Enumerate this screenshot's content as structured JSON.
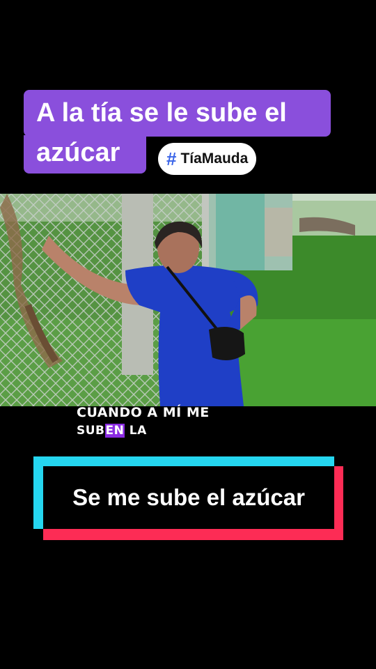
{
  "title": {
    "line1": "A la tía se le sube el",
    "line2": "azúcar"
  },
  "hashtag": {
    "symbol": "#",
    "label": "TíaMauda"
  },
  "caption": {
    "line1": "CUANDO A MÍ ME",
    "line2_pre": "SUB",
    "line2_highlight": "EN",
    "line2_post": " LA"
  },
  "banner": {
    "text": "Se me sube el azúcar"
  },
  "colors": {
    "title_bg": "#8a4fdc",
    "hashtag_symbol": "#3a64e8",
    "banner_cyan": "#25d6f0",
    "banner_red": "#fd2c55",
    "caption_highlight": "#8a2be2"
  }
}
